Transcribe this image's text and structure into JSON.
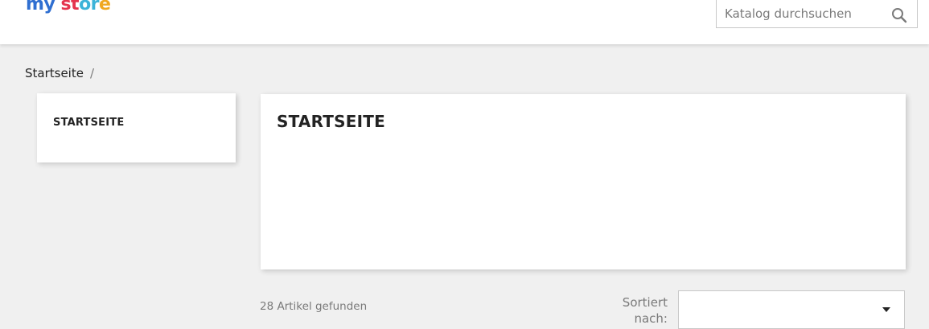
{
  "header": {
    "logo": {
      "part1": "my",
      "part2": "st",
      "part3": "or",
      "part4": "e"
    },
    "search": {
      "placeholder": "Katalog durchsuchen"
    }
  },
  "breadcrumb": {
    "items": [
      "Startseite"
    ],
    "separator": "/"
  },
  "sidebar": {
    "title": "STARTSEITE"
  },
  "main": {
    "title": "STARTSEITE"
  },
  "listing": {
    "count_text": "28 Artikel gefunden",
    "sort_label": "Sortiert nach:",
    "sort_value": ""
  },
  "colors": {
    "page_background": "#f0f0f0",
    "logo_blue": "#2f6fd1",
    "logo_red": "#e4344d",
    "logo_cyan": "#3cb3d8",
    "logo_orange": "#f0a81f"
  },
  "icons": {
    "search": "search-icon",
    "sort_caret": "caret-down-icon"
  }
}
